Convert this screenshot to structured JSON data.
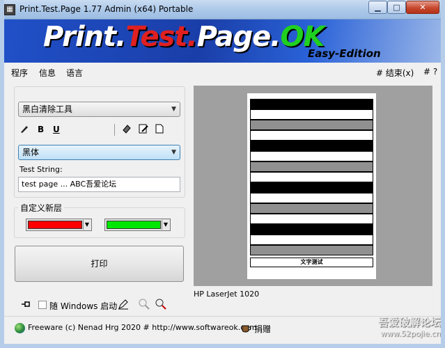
{
  "window": {
    "title": "Print.Test.Page 1.77 Admin (x64) Portable",
    "min_label": "▁",
    "max_label": "□",
    "close_label": "✕"
  },
  "banner": {
    "part1": "Print.",
    "part2": "Test.",
    "part3": "Page.",
    "part4": "OK",
    "edition": "Easy-Edition"
  },
  "menu": {
    "items": [
      "程序",
      "信息",
      "语言"
    ],
    "end": "# 结束(x)",
    "help": "# ?"
  },
  "tools": {
    "mode_select": "黑白清除工具",
    "font_select": "黑体",
    "bold": "B",
    "underline": "U",
    "test_string_label": "Test String:",
    "test_string_value": "test page ... ABC吾爱论坛"
  },
  "layer": {
    "label": "自定义新层",
    "color1": "#ff0000",
    "color2": "#00e600"
  },
  "print_button": "打印",
  "startup": {
    "label": "随 Windows 启动"
  },
  "preview": {
    "printer": "HP LaserJet 1020",
    "footer_text": "文字测试"
  },
  "status": {
    "text": "Freeware (c) Nenad Hrg 2020 # http://www.softwareok.com",
    "donate": "捐赠"
  },
  "watermark": {
    "line1": "吾爱破解论坛",
    "line2": "www.52pojie.cn"
  }
}
